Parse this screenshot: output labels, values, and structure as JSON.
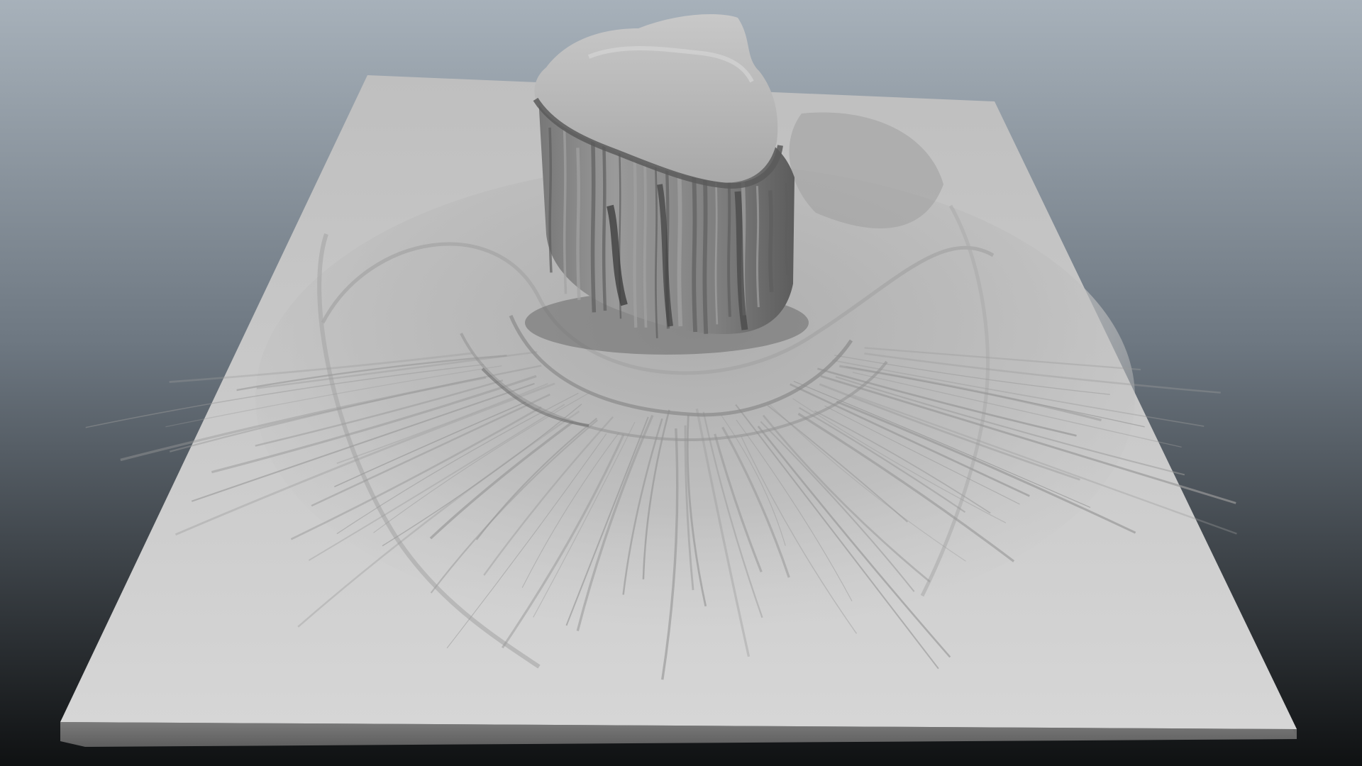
{
  "viewport": {
    "name": "3d-viewport",
    "background_top": "#a7b1ba",
    "background_mid": "#6d7781",
    "background_bottom": "#0f1112"
  },
  "scene": {
    "terrain_color": "#c8c8c8",
    "terrain_side_color": "#737373",
    "rock_color": "#8c8c8c",
    "rock_top_color": "#bdbdbd",
    "rock_shadow_color": "#3e3e3e",
    "erosion_line_color": "#9a9a9a"
  }
}
